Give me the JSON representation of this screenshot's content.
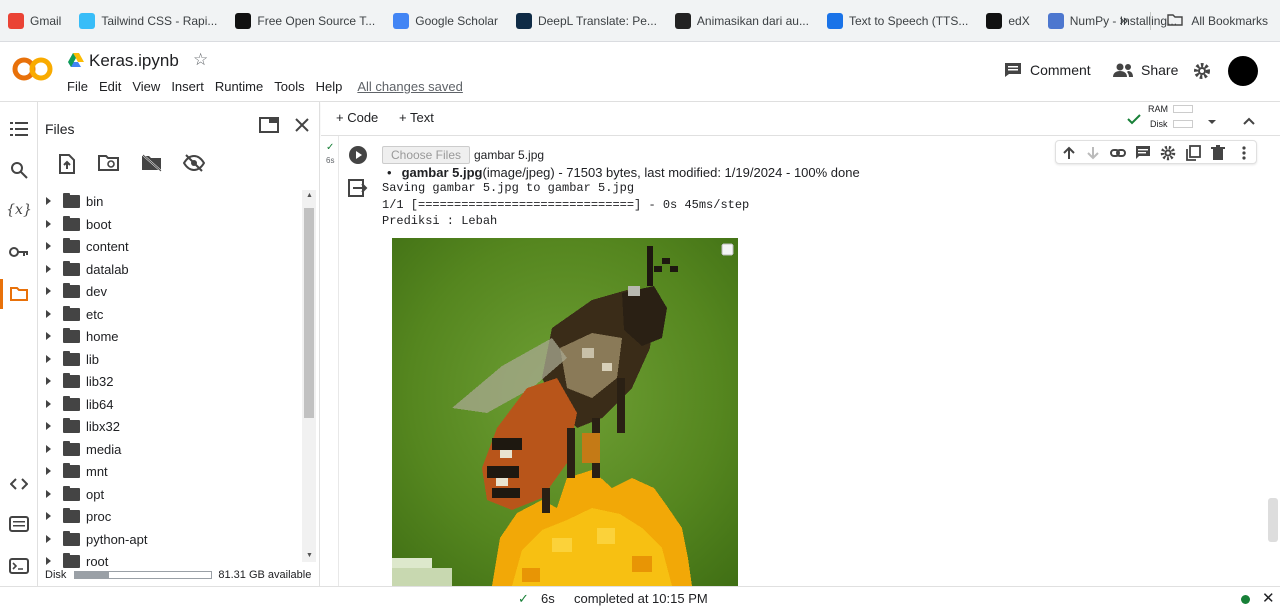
{
  "bookmarks": [
    {
      "label": "Gmail",
      "icon": "gmail-icon",
      "color": "#ea4335"
    },
    {
      "label": "Tailwind CSS - Rapi...",
      "icon": "tailwind-icon",
      "color": "#38bdf8"
    },
    {
      "label": "Free Open Source T...",
      "icon": "ui-icon",
      "color": "#111111"
    },
    {
      "label": "Google Scholar",
      "icon": "scholar-icon",
      "color": "#4285f4"
    },
    {
      "label": "DeepL Translate: Pe...",
      "icon": "deepl-icon",
      "color": "#0f2b46"
    },
    {
      "label": "Animasikan dari au...",
      "icon": "animasikan-icon",
      "color": "#222222"
    },
    {
      "label": "Text to Speech (TTS...",
      "icon": "tts-icon",
      "color": "#1a73e8"
    },
    {
      "label": "edX",
      "icon": "edx-icon",
      "color": "#111111"
    },
    {
      "label": "NumPy - Installing...",
      "icon": "numpy-icon",
      "color": "#4d77cf"
    }
  ],
  "bookmarks_more": "»",
  "all_bookmarks": "All Bookmarks",
  "header": {
    "title": "Keras.ipynb",
    "menu": [
      "File",
      "Edit",
      "View",
      "Insert",
      "Runtime",
      "Tools",
      "Help"
    ],
    "saved_status": "All changes saved",
    "comment_label": "Comment",
    "share_label": "Share",
    "logo_text": "CO"
  },
  "files_panel": {
    "title": "Files",
    "folders": [
      "bin",
      "boot",
      "content",
      "datalab",
      "dev",
      "etc",
      "home",
      "lib",
      "lib32",
      "lib64",
      "libx32",
      "media",
      "mnt",
      "opt",
      "proc",
      "python-apt",
      "root"
    ],
    "disk_label": "Disk",
    "disk_available": "81.31 GB available",
    "disk_used_fraction": 0.25
  },
  "toolbar": {
    "add_code": "+ Code",
    "add_text": "+ Text",
    "ram_label": "RAM",
    "disk_label": "Disk"
  },
  "cell": {
    "exec_check": "✓",
    "exec_time": "6s",
    "choose_files": "Choose Files",
    "chosen_file": "gambar 5.jpg",
    "file_name_bold": "gambar 5.jpg",
    "file_info": "(image/jpeg) - 71503 bytes, last modified: 1/19/2024 - 100% done",
    "output_lines": [
      "Saving gambar 5.jpg to gambar 5.jpg",
      "1/1 [==============================] - 0s 45ms/step",
      "Prediksi : Lebah"
    ]
  },
  "status_bar": {
    "check": "✓",
    "time": "6s",
    "completed": "completed at 10:15 PM",
    "close": "✕"
  },
  "colors": {
    "accent_orange": "#e8710a",
    "logo_yellow": "#f9ab00",
    "success_green": "#188038"
  }
}
